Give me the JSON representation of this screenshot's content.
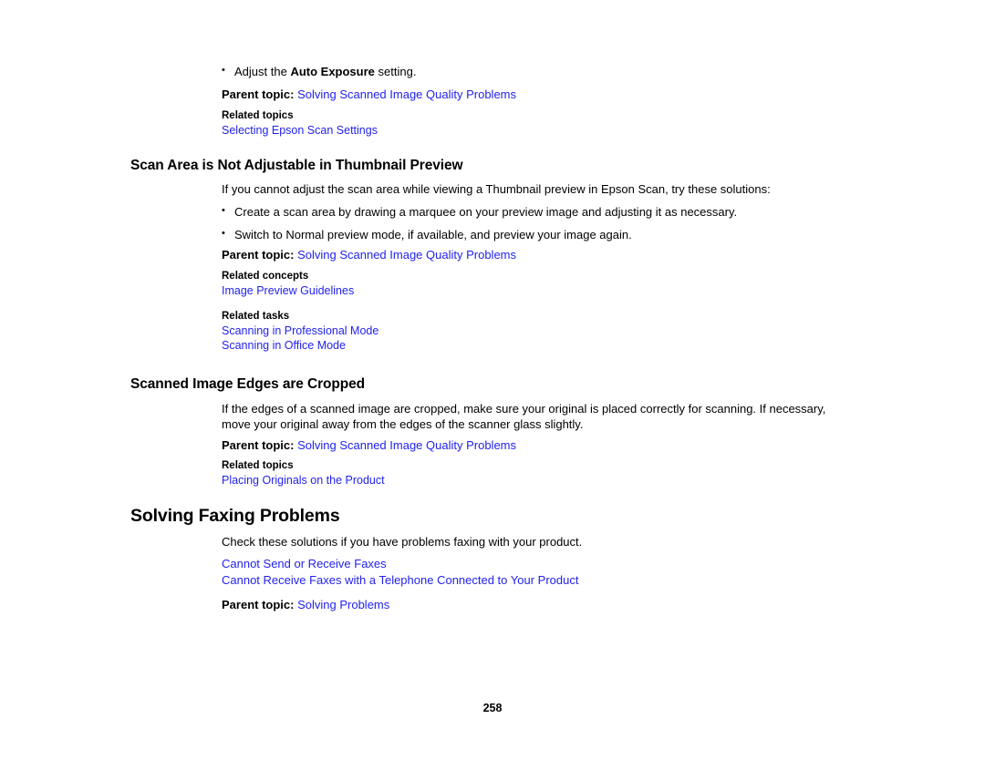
{
  "page": {
    "number": "258",
    "link_color": "#2222ee",
    "text_color": "#000000",
    "background": "#ffffff"
  },
  "continued_section": {
    "bullet": {
      "prefix": "Adjust the ",
      "bold": "Auto Exposure",
      "suffix": " setting."
    },
    "parent_topic": {
      "label": "Parent topic:",
      "link": "Solving Scanned Image Quality Problems"
    },
    "related": {
      "label": "Related topics",
      "links": [
        "Selecting Epson Scan Settings"
      ]
    }
  },
  "sections": [
    {
      "title": "Scan Area is Not Adjustable in Thumbnail Preview",
      "intro": "If you cannot adjust the scan area while viewing a Thumbnail preview in Epson Scan, try these solutions:",
      "bullets": [
        "Create a scan area by drawing a marquee on your preview image and adjusting it as necessary.",
        "Switch to Normal preview mode, if available, and preview your image again."
      ],
      "parent_topic": {
        "label": "Parent topic:",
        "link": "Solving Scanned Image Quality Problems"
      },
      "related_groups": [
        {
          "label": "Related concepts",
          "links": [
            "Image Preview Guidelines"
          ]
        },
        {
          "label": "Related tasks",
          "links": [
            "Scanning in Professional Mode",
            "Scanning in Office Mode"
          ]
        }
      ]
    },
    {
      "title": "Scanned Image Edges are Cropped",
      "intro": "If the edges of a scanned image are cropped, make sure your original is placed correctly for scanning. If necessary, move your original away from the edges of the scanner glass slightly.",
      "bullets": [],
      "parent_topic": {
        "label": "Parent topic:",
        "link": "Solving Scanned Image Quality Problems"
      },
      "related_groups": [
        {
          "label": "Related topics",
          "links": [
            "Placing Originals on the Product"
          ]
        }
      ]
    }
  ],
  "chapter": {
    "title": "Solving Faxing Problems",
    "intro": "Check these solutions if you have problems faxing with your product.",
    "links": [
      "Cannot Send or Receive Faxes",
      "Cannot Receive Faxes with a Telephone Connected to Your Product"
    ],
    "parent_topic": {
      "label": "Parent topic:",
      "link": "Solving Problems"
    }
  }
}
